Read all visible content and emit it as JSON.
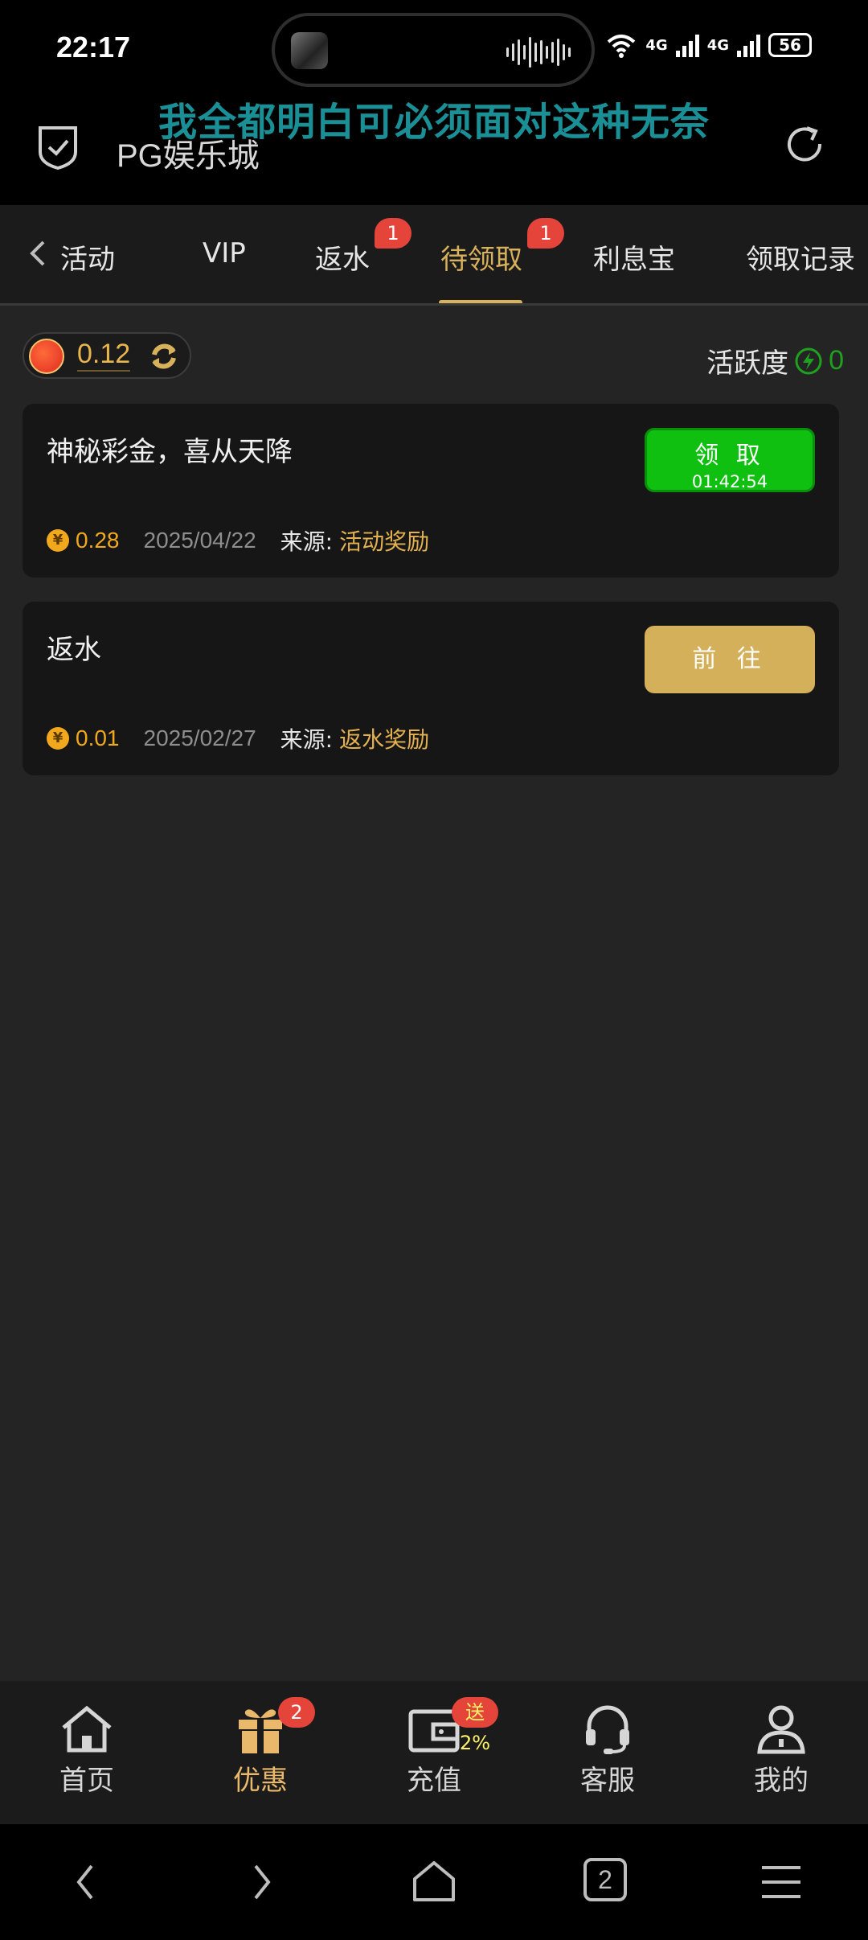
{
  "status_bar": {
    "time": "22:17",
    "signal_1": "4G",
    "signal_2": "4G",
    "battery": "56"
  },
  "caption": "我全都明白可必须面对这种无奈",
  "header": {
    "title": "PG娱乐城",
    "shield_icon": "shield-check-icon",
    "refresh_icon": "refresh-icon"
  },
  "tabs": {
    "items": [
      {
        "label": "活动"
      },
      {
        "label": "VIP"
      },
      {
        "label": "返水",
        "badge": "1"
      },
      {
        "label": "待领取",
        "badge": "1",
        "active": true
      },
      {
        "label": "利息宝"
      },
      {
        "label": "领取记录"
      }
    ],
    "accent": "#d8b25a"
  },
  "balance": {
    "value": "0.12",
    "flag_icon": "china-flag-icon",
    "refresh_icon": "refresh-icon"
  },
  "activity": {
    "label": "活跃度",
    "value": "0",
    "icon": "bolt-icon"
  },
  "rewards": [
    {
      "title": "神秘彩金，喜从天降",
      "button_label": "领 取",
      "button_timer": "01:42:54",
      "amount": "0.28",
      "date": "2025/04/22",
      "source_label": "来源:",
      "source_value": "活动奖励"
    },
    {
      "title": "返水",
      "button_label": "前 往",
      "amount": "0.01",
      "date": "2025/02/27",
      "source_label": "来源:",
      "source_value": "返水奖励"
    }
  ],
  "coin_symbol": "¥",
  "bottom_nav": {
    "items": [
      {
        "label": "首页",
        "icon": "home-icon"
      },
      {
        "label": "优惠",
        "icon": "gift-icon",
        "badge": "2",
        "active": true
      },
      {
        "label": "充值",
        "icon": "wallet-icon",
        "badge": "送2%"
      },
      {
        "label": "客服",
        "icon": "headset-icon"
      },
      {
        "label": "我的",
        "icon": "user-icon"
      }
    ]
  },
  "system_nav": {
    "tab_count": "2"
  },
  "colors": {
    "gold": "#d8b25a",
    "green_button": "#10c010",
    "badge_red": "#e5443b",
    "background": "#242424"
  }
}
